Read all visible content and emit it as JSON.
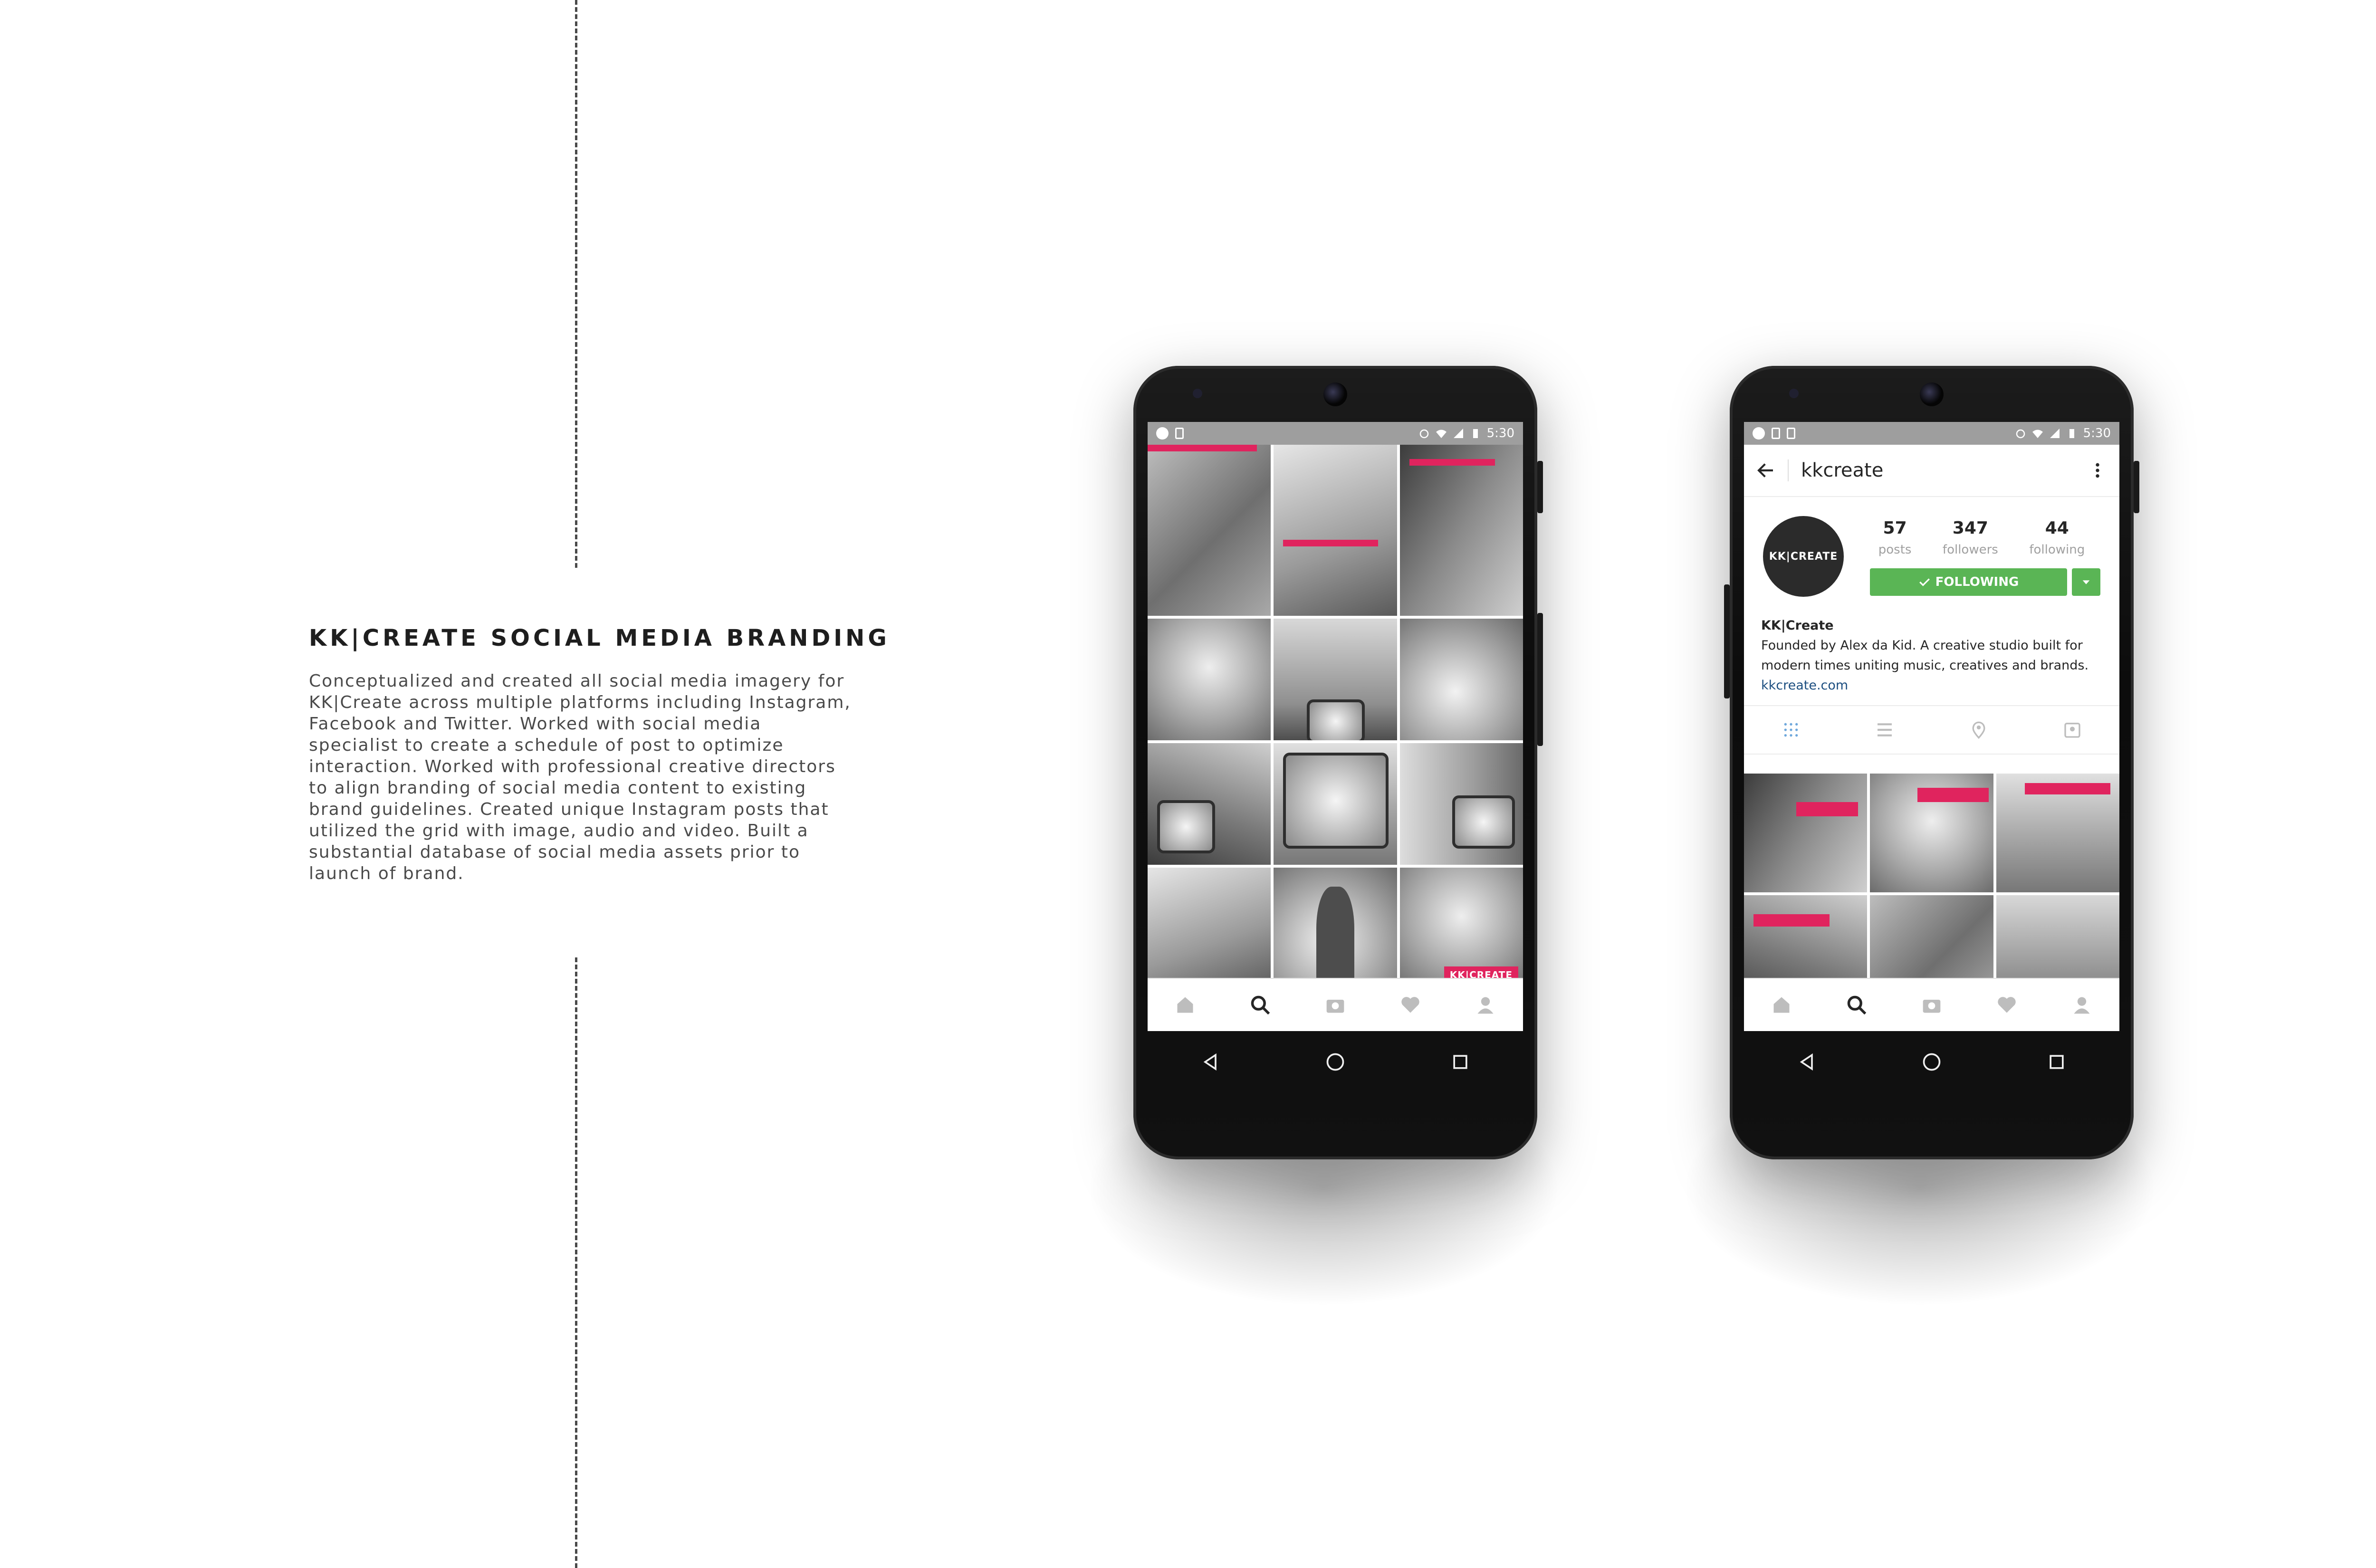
{
  "project": {
    "title": "KK|CREATE SOCIAL MEDIA BRANDING",
    "description": "Conceptualized and created all social media imagery for KK|Create across multiple platforms including Instagram, Facebook and Twitter. Worked with social media specialist to create a schedule of post to optimize interaction. Worked with professional creative directors to align branding of social media content to existing brand guidelines. Created unique Instagram posts that utilized the grid with image, audio and video. Built a substantial database of social media assets prior to launch of brand."
  },
  "phone_left": {
    "status_time": "5:30",
    "brand_badge": "KK|CREATE",
    "nav_icons": [
      "home-icon",
      "search-icon",
      "camera-icon",
      "heart-icon",
      "profile-icon"
    ]
  },
  "phone_right": {
    "status_time": "5:30",
    "username": "kkcreate",
    "avatar_text": "KK|CREATE",
    "stats": [
      {
        "value": "57",
        "label": "posts"
      },
      {
        "value": "347",
        "label": "followers"
      },
      {
        "value": "44",
        "label": "following"
      }
    ],
    "follow_label": "FOLLOWING",
    "bio": {
      "name": "KK|Create",
      "text": "Founded by Alex da Kid. A creative studio built for modern times uniting music, creatives and brands.",
      "link": "kkcreate.com"
    },
    "tabs": [
      "grid-icon",
      "list-icon",
      "location-icon",
      "tagged-icon"
    ]
  },
  "colors": {
    "accent_pink": "#e0245e",
    "follow_green": "#5ab555",
    "link_blue": "#1c4e80"
  }
}
